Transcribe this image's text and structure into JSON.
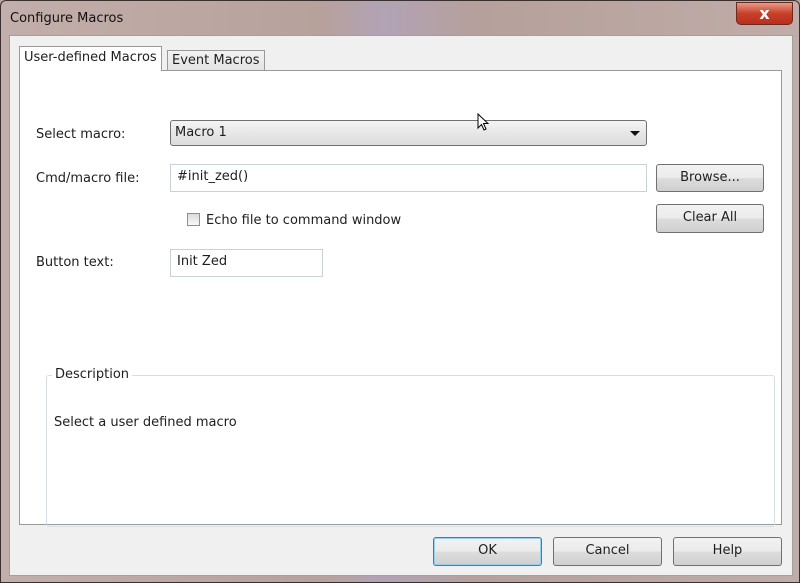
{
  "window": {
    "title": "Configure Macros",
    "close_label": "x"
  },
  "tabs": [
    {
      "label": "User-defined Macros",
      "active": true
    },
    {
      "label": "Event Macros",
      "active": false
    }
  ],
  "form": {
    "select_macro_label": "Select macro:",
    "select_macro_value": "Macro 1",
    "cmd_file_label": "Cmd/macro file:",
    "cmd_file_value": "#init_zed()",
    "echo_label": "Echo file to command window",
    "echo_checked": false,
    "button_text_label": "Button text:",
    "button_text_value": "Init Zed",
    "browse_label": "Browse...",
    "clear_all_label": "Clear All"
  },
  "description": {
    "title": "Description",
    "text": "Select a user defined macro"
  },
  "footer": {
    "ok_label": "OK",
    "cancel_label": "Cancel",
    "help_label": "Help"
  }
}
